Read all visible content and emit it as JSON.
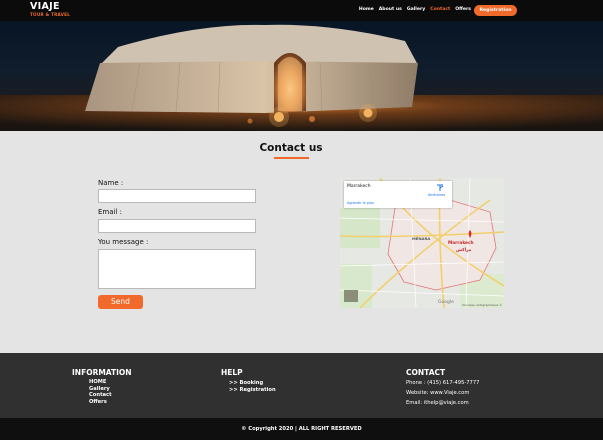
{
  "header": {
    "brand": "VIAJE",
    "tagline": "TOUR & TRAVEL",
    "nav": [
      "Home",
      "About us",
      "Gallery",
      "Contact",
      "Offers"
    ],
    "active_nav": "Contact",
    "registration_label": "Registration"
  },
  "contact": {
    "title": "Contact us",
    "name_label": "Name :",
    "email_label": "Email :",
    "message_label": "You message :",
    "name_value": "",
    "email_value": "",
    "message_value": "",
    "send_label": "Send"
  },
  "map": {
    "place": "Marrakech",
    "directions_label": "Itinéraires",
    "larger_map_label": "Agrandir le plan",
    "city_labels": [
      "Marrakech",
      "مراكش",
      "MÉNARA",
      "Google"
    ],
    "credit": "Données cartographiques ©"
  },
  "footer": {
    "information_title": "INFORMATION",
    "information_items": [
      "HOME",
      "Gallery",
      "Contact",
      "Offers"
    ],
    "help_title": "HELP",
    "help_items": [
      ">> Booking",
      ">> Registration"
    ],
    "contact_title": "CONTACT",
    "phone": "Phone : (415) 617-495-7777",
    "website": "Website: www.Viaje.com",
    "email": "Email: ithelp@viaje.com",
    "copyright": "© Copyright 2020 | ALL RIGHT RESERVED"
  },
  "colors": {
    "accent": "#f26a2b",
    "nav_bg": "#0b0b0b",
    "footer_bg": "#303030",
    "bottom_bg": "#0f0f0f",
    "page_bg": "#e4e4e4"
  }
}
